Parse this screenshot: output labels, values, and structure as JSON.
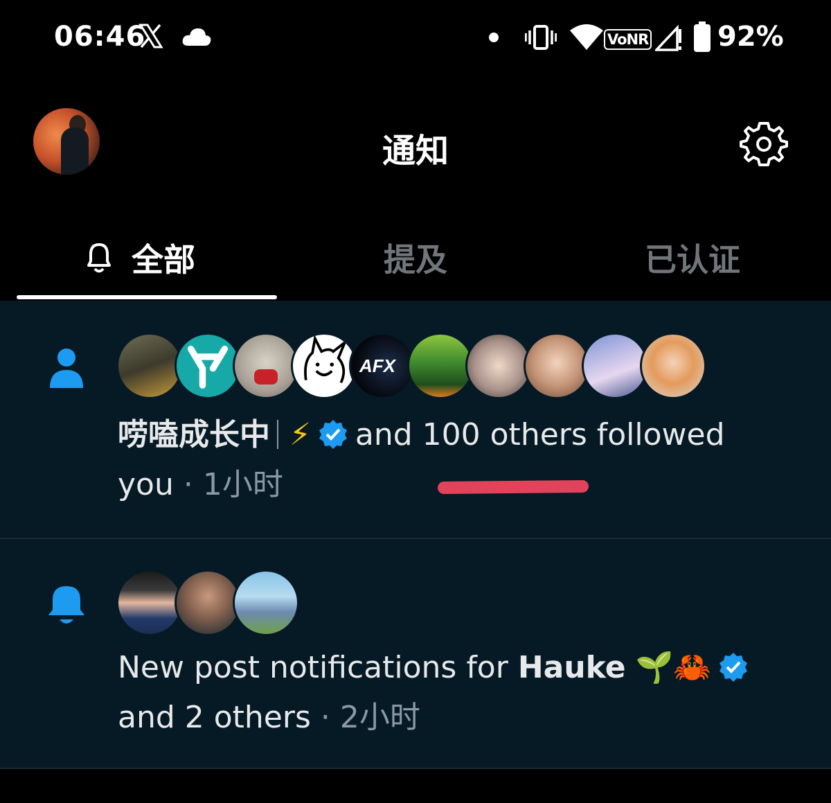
{
  "status_bar": {
    "time": "06:46",
    "network_label": "VoNR",
    "battery_percent": "92%",
    "icons": [
      "x-logo-icon",
      "cloud-icon",
      "dot-icon",
      "vibrate-icon",
      "wifi-icon",
      "signal-icon",
      "battery-icon"
    ]
  },
  "header": {
    "title": "通知",
    "avatar": "profile-avatar",
    "settings_icon": "gear-icon"
  },
  "tabs": [
    {
      "label": "全部",
      "active": true,
      "icon": "bell-outline-icon"
    },
    {
      "label": "提及",
      "active": false
    },
    {
      "label": "已认证",
      "active": false
    }
  ],
  "notifications": [
    {
      "type": "follow",
      "icon": "person-icon",
      "avatar_count": 10,
      "actor_name": "唠嗑成长中",
      "actor_emoji": "⚡",
      "rest_text": "and 100 others followed",
      "rest_text_2": "you",
      "separator": "·",
      "time": "1小时"
    },
    {
      "type": "new_post",
      "icon": "bell-filled-icon",
      "avatar_count": 3,
      "prefix": "New post notifications for",
      "actor_name": "Hauke",
      "actor_emoji": "🌱🦀",
      "rest_text": "and 2 others",
      "separator": "·",
      "time": "2小时"
    }
  ],
  "colors": {
    "background": "#000000",
    "notification_bg": "#061a26",
    "accent_blue": "#1d9bf0",
    "muted_text": "#8b98a5",
    "annotation_red": "#e0435a"
  }
}
